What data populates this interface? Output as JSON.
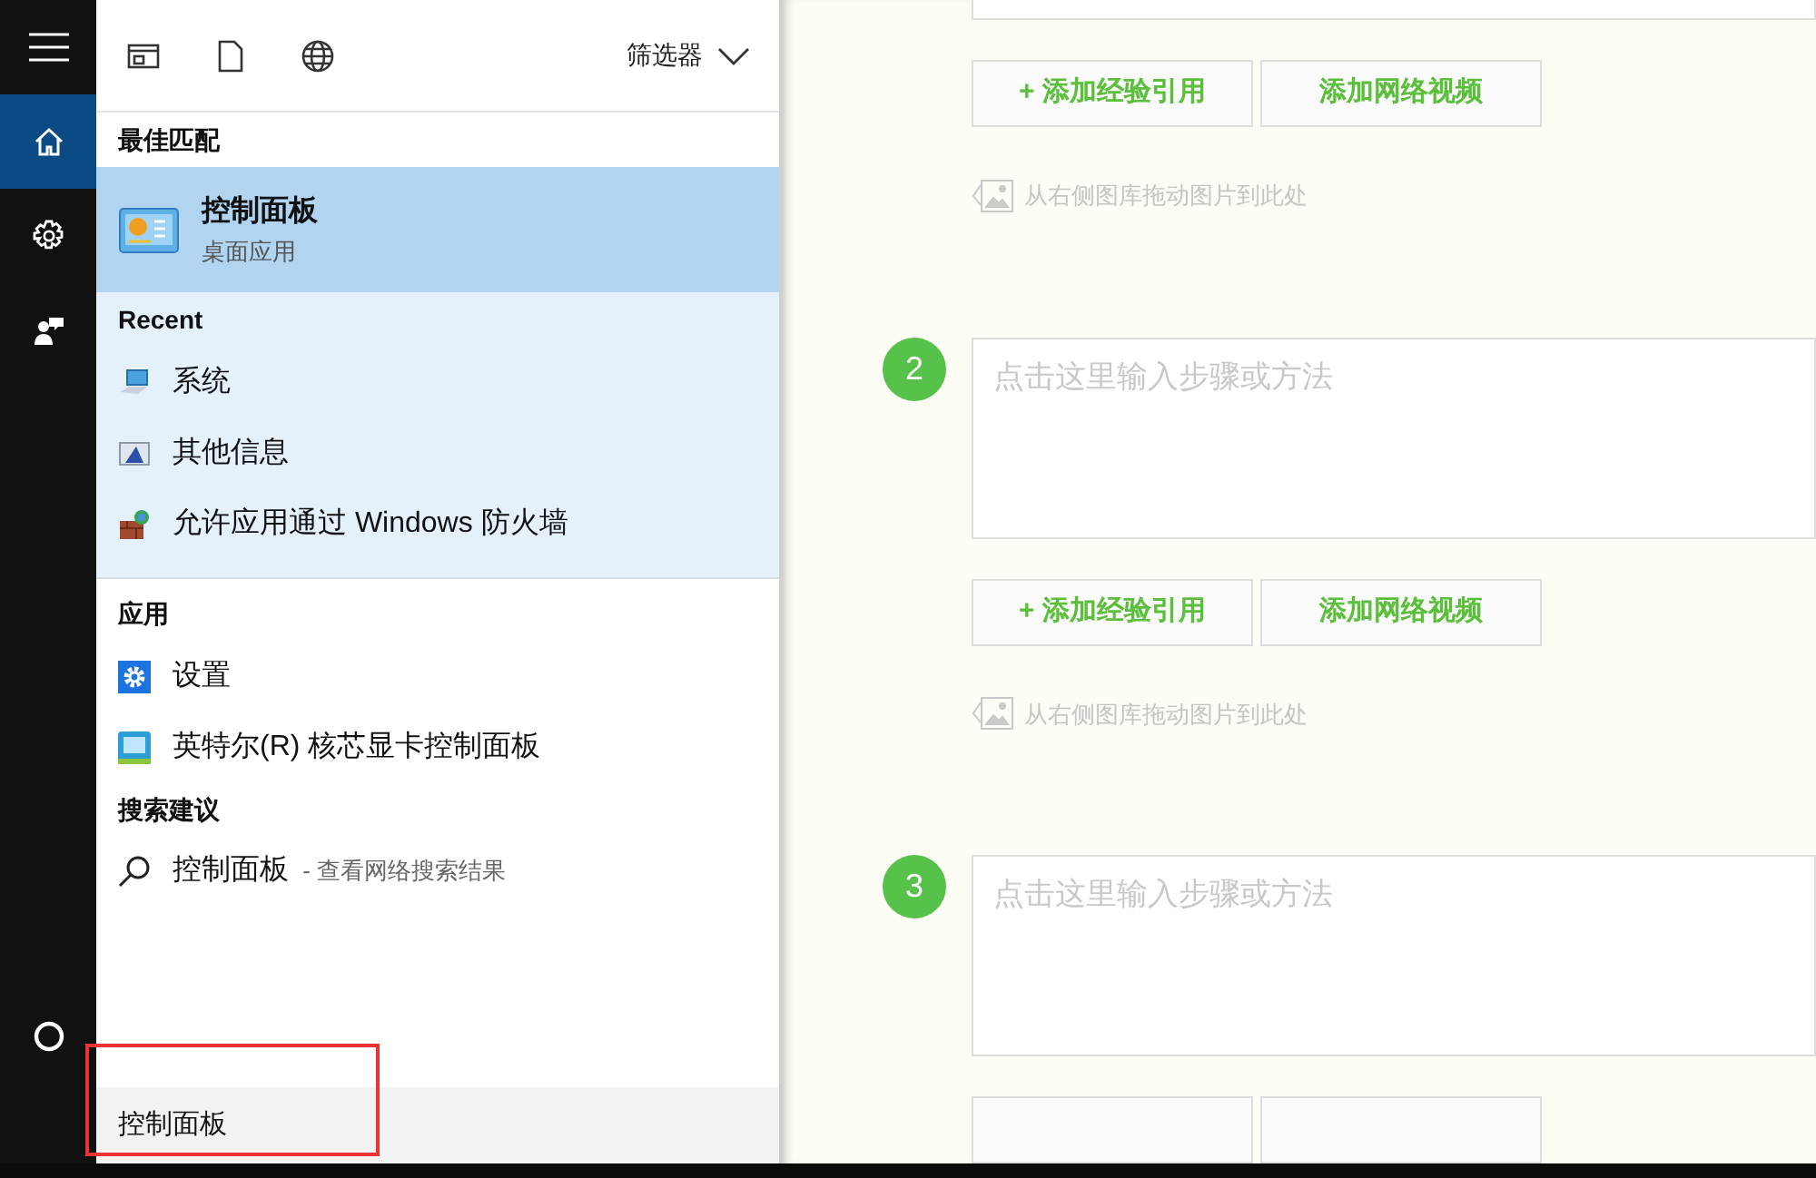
{
  "sidebar": {
    "items": [
      {
        "kind": "menu",
        "selected": false
      },
      {
        "kind": "home",
        "selected": true
      },
      {
        "kind": "settings",
        "selected": false
      },
      {
        "kind": "feedback",
        "selected": false
      },
      {
        "kind": "cortana",
        "selected": false
      }
    ]
  },
  "search_panel": {
    "filters": [
      "筛选器"
    ],
    "sections": [
      {
        "title": "最佳匹配",
        "kind": "best",
        "items": [
          {
            "title": "控制面板",
            "subtitle": "桌面应用",
            "kind": "control",
            "selected": true
          }
        ]
      },
      {
        "title": "Recent",
        "kind": "recent",
        "items": [
          {
            "title": "系统",
            "kind": "system",
            "selected": false
          },
          {
            "title": "其他信息",
            "kind": "info",
            "selected": false
          },
          {
            "title": "允许应用通过 Windows 防火墙",
            "kind": "firewall",
            "selected": false
          }
        ]
      },
      {
        "title": "应用",
        "kind": "apps",
        "items": [
          {
            "title": "设置",
            "kind": "settings",
            "selected": false
          },
          {
            "title": "英特尔(R) 核芯显卡控制面板",
            "kind": "intel",
            "selected": false
          }
        ]
      },
      {
        "title": "搜索建议",
        "kind": "web",
        "items": [
          {
            "title": "控制面板",
            "subtitle": " - 查看网络搜索结果",
            "kind": "search",
            "selected": false
          }
        ]
      }
    ],
    "search_box": {
      "value": "控制面板"
    }
  },
  "editor": {
    "top_buttons": [
      "+ 添加经验引用",
      "添加网络视频"
    ],
    "top_hint": "从右侧图库拖动图片到此处",
    "steps": [
      {
        "number": "2",
        "placeholder": "点击这里输入步骤或方法",
        "buttons": [
          "+ 添加经验引用",
          "添加网络视频"
        ],
        "hint": "从右侧图库拖动图片到此处"
      },
      {
        "number": "3",
        "placeholder": "点击这里输入步骤或方法"
      }
    ]
  }
}
